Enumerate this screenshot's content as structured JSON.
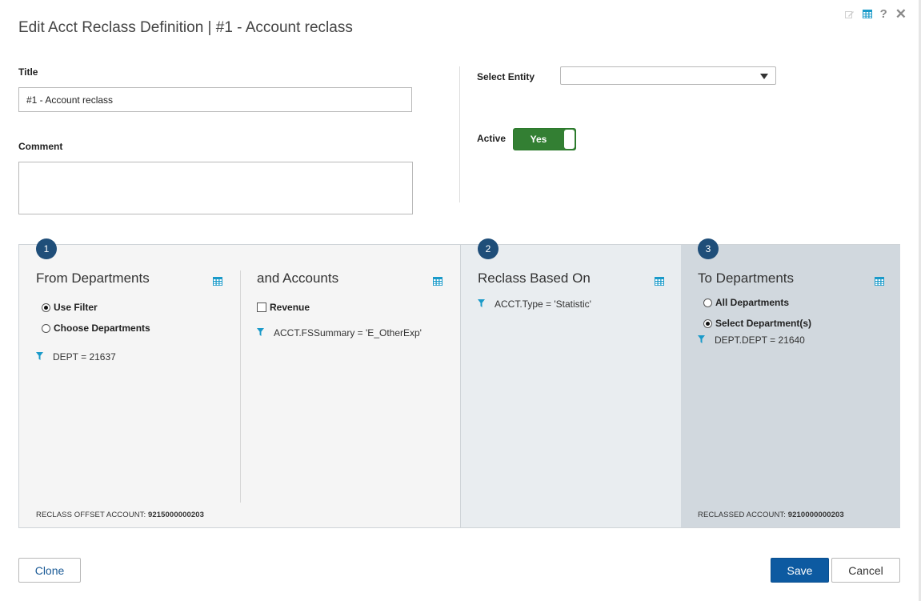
{
  "dialog": {
    "title": "Edit Acct Reclass Definition | #1 - Account reclass"
  },
  "header_icons": {
    "edit": "edit-icon",
    "grid": "grid-icon",
    "help_label": "?",
    "close_label": "✕"
  },
  "form": {
    "title_label": "Title",
    "title_value": "#1 - Account reclass",
    "comment_label": "Comment",
    "comment_value": "",
    "entity_label": "Select Entity",
    "entity_value": "",
    "active_label": "Active",
    "active_value": "Yes"
  },
  "sections": {
    "from": {
      "step": "1",
      "title": "From Departments",
      "options": [
        "Use Filter",
        "Choose Departments"
      ],
      "selected": "Use Filter",
      "filter": "DEPT = 21637",
      "footnote_label": "RECLASS OFFSET ACCOUNT:",
      "footnote_value": "9215000000203"
    },
    "accounts": {
      "title": "and Accounts",
      "checkbox_label": "Revenue",
      "checked": false,
      "filter": "ACCT.FSSummary = 'E_OtherExp'"
    },
    "based_on": {
      "step": "2",
      "title": "Reclass Based On",
      "filter": "ACCT.Type = 'Statistic'"
    },
    "to": {
      "step": "3",
      "title": "To Departments",
      "options": [
        "All Departments",
        "Select Department(s)"
      ],
      "selected": "Select Department(s)",
      "filter": "DEPT.DEPT = 21640",
      "footnote_label": "RECLASSED ACCOUNT:",
      "footnote_value": "9210000000203"
    }
  },
  "buttons": {
    "clone": "Clone",
    "save": "Save",
    "cancel": "Cancel"
  },
  "colors": {
    "accent": "#1f4e79",
    "toggle_on": "#337f33",
    "save": "#0d5aa1",
    "filter_icon": "#1a9ac9"
  }
}
